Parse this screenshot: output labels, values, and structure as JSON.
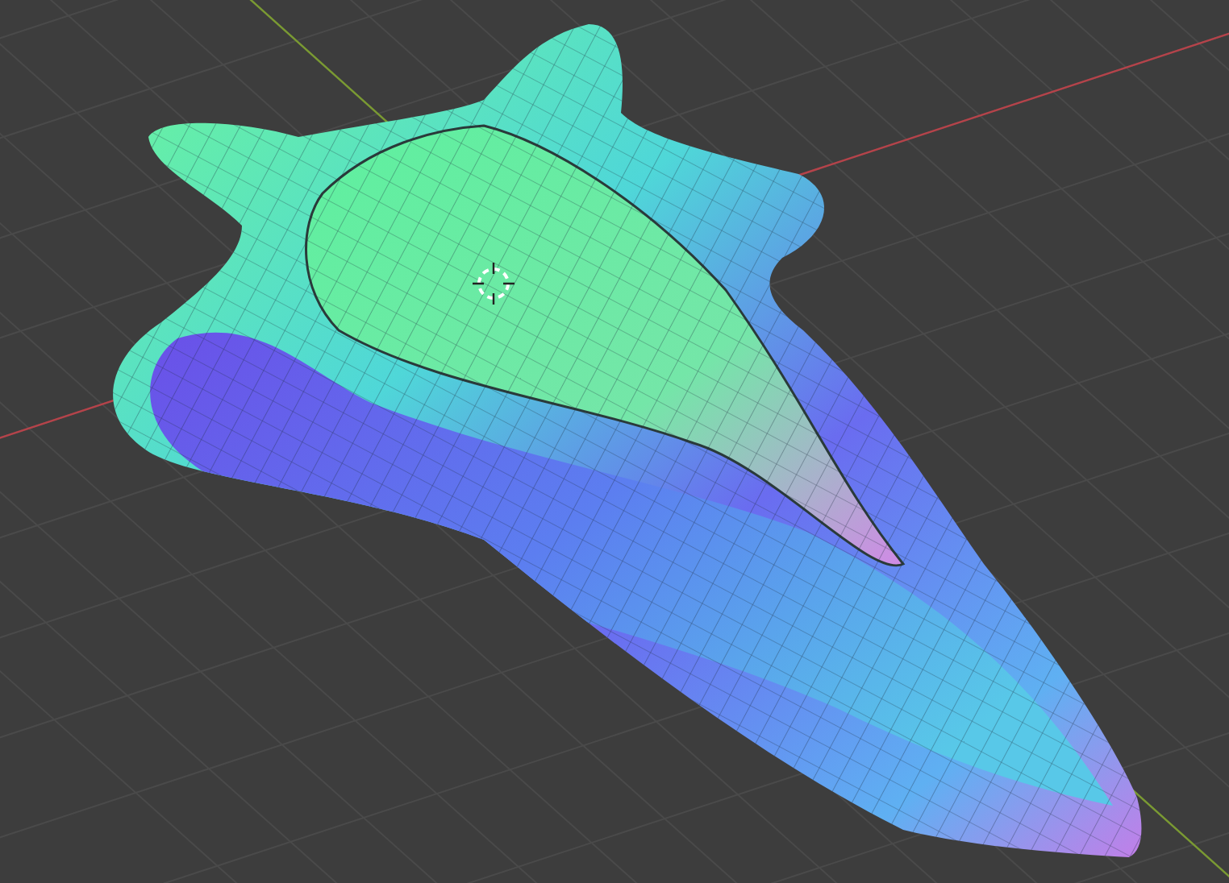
{
  "viewport": {
    "show_grid": true,
    "show_cursor": true,
    "axes": [
      {
        "kind": "x",
        "color": "#b5434a"
      },
      {
        "kind": "y",
        "color": "#7a9a32"
      }
    ]
  }
}
